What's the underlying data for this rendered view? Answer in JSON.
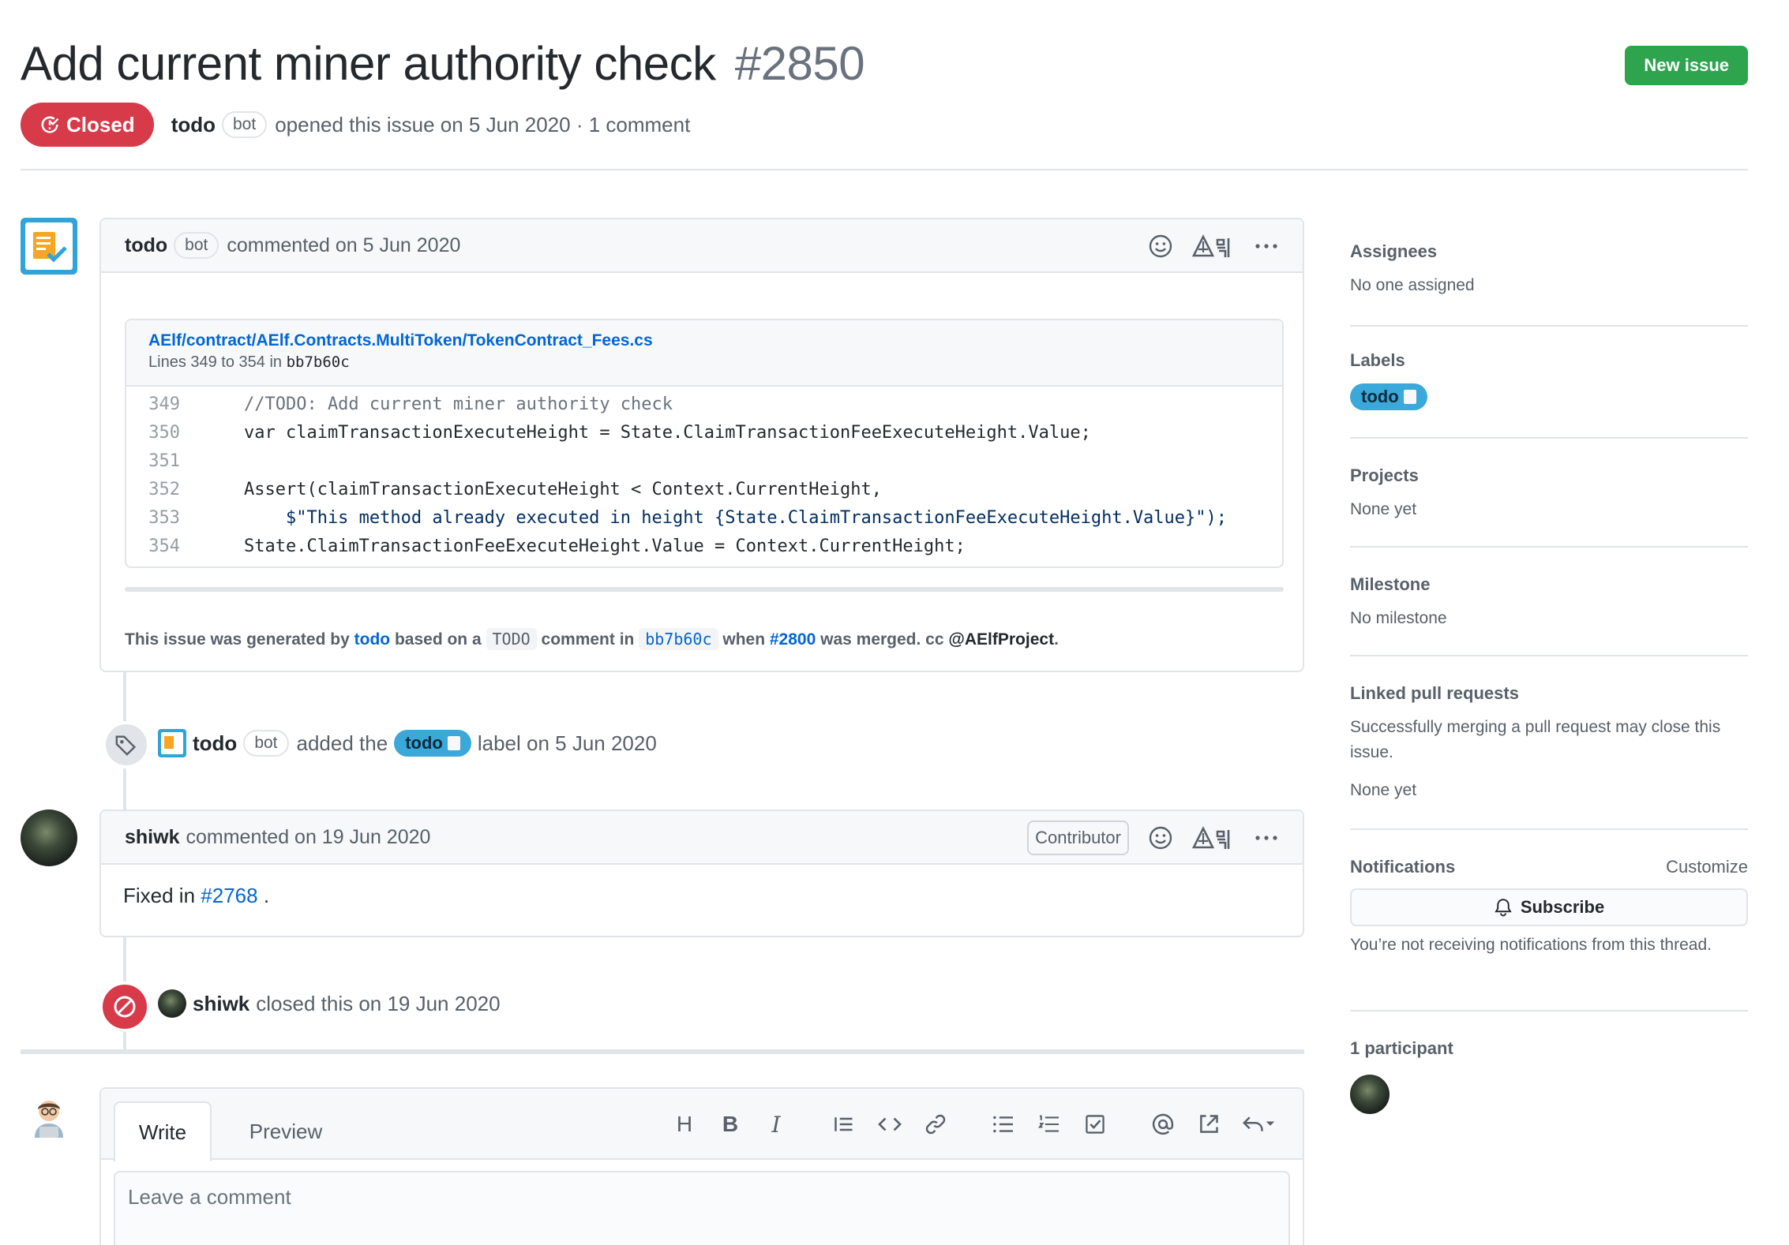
{
  "issue": {
    "title": "Add current miner authority check",
    "number": "#2850",
    "new_issue_label": "New issue",
    "state_label": "Closed",
    "author": "todo",
    "author_tag": "bot",
    "meta": "opened this issue on 5 Jun 2020 · 1 comment"
  },
  "comment1": {
    "author": "todo",
    "author_tag": "bot",
    "meta": "commented on 5 Jun 2020",
    "code": {
      "path": "AElf/contract/AElf.Contracts.MultiToken/TokenContract_Fees.cs",
      "lines_prefix": "Lines 349 to 354 in",
      "commit": "bb7b60c",
      "lines": [
        {
          "n": "349",
          "t": "    //TODO: Add current miner authority check"
        },
        {
          "n": "350",
          "t": "    var claimTransactionExecuteHeight = State.ClaimTransactionFeeExecuteHeight.Value;"
        },
        {
          "n": "351",
          "t": ""
        },
        {
          "n": "352",
          "t": "    Assert(claimTransactionExecuteHeight < Context.CurrentHeight,"
        },
        {
          "n": "353",
          "t": "        $\"This method already executed in height {State.ClaimTransactionFeeExecuteHeight.Value}\");"
        },
        {
          "n": "354",
          "t": "    State.ClaimTransactionFeeExecuteHeight.Value = Context.CurrentHeight;"
        }
      ]
    },
    "footer": {
      "p1": "This issue was generated by",
      "link1": "todo",
      "p2": "based on a",
      "code1": "TODO",
      "p3": "comment in",
      "code2": "bb7b60c",
      "p4": "when",
      "link2": "#2800",
      "p5": "was merged. cc",
      "mention": "@AElfProject",
      "p6": "."
    }
  },
  "event_label": {
    "actor": "todo",
    "actor_tag": "bot",
    "p1": "added the",
    "label": "todo",
    "p2": "label on 5 Jun 2020"
  },
  "comment2": {
    "author": "shiwk",
    "meta": "commented on 19 Jun 2020",
    "badge": "Contributor",
    "body_prefix": "Fixed in",
    "body_link": "#2768",
    "body_suffix": " ."
  },
  "event_closed": {
    "actor": "shiwk",
    "text": "closed this on 19 Jun 2020"
  },
  "editor": {
    "tab_write": "Write",
    "tab_preview": "Preview",
    "placeholder": "Leave a comment",
    "tools": [
      "H",
      "B",
      "I"
    ]
  },
  "sidebar": {
    "assignees": {
      "title": "Assignees",
      "value": "No one assigned"
    },
    "labels": {
      "title": "Labels",
      "label": "todo"
    },
    "projects": {
      "title": "Projects",
      "value": "None yet"
    },
    "milestone": {
      "title": "Milestone",
      "value": "No milestone"
    },
    "linked": {
      "title": "Linked pull requests",
      "desc": "Successfully merging a pull request may close this issue.",
      "value": "None yet"
    },
    "notifications": {
      "title": "Notifications",
      "customize": "Customize",
      "subscribe": "Subscribe",
      "desc": "You’re not receiving notifications from this thread."
    },
    "participants": {
      "title": "1 participant"
    }
  },
  "colors": {
    "closed": "#d73a49",
    "new_issue": "#2ea44f",
    "link": "#0366d6",
    "label_todo": "#3aa8d8"
  }
}
